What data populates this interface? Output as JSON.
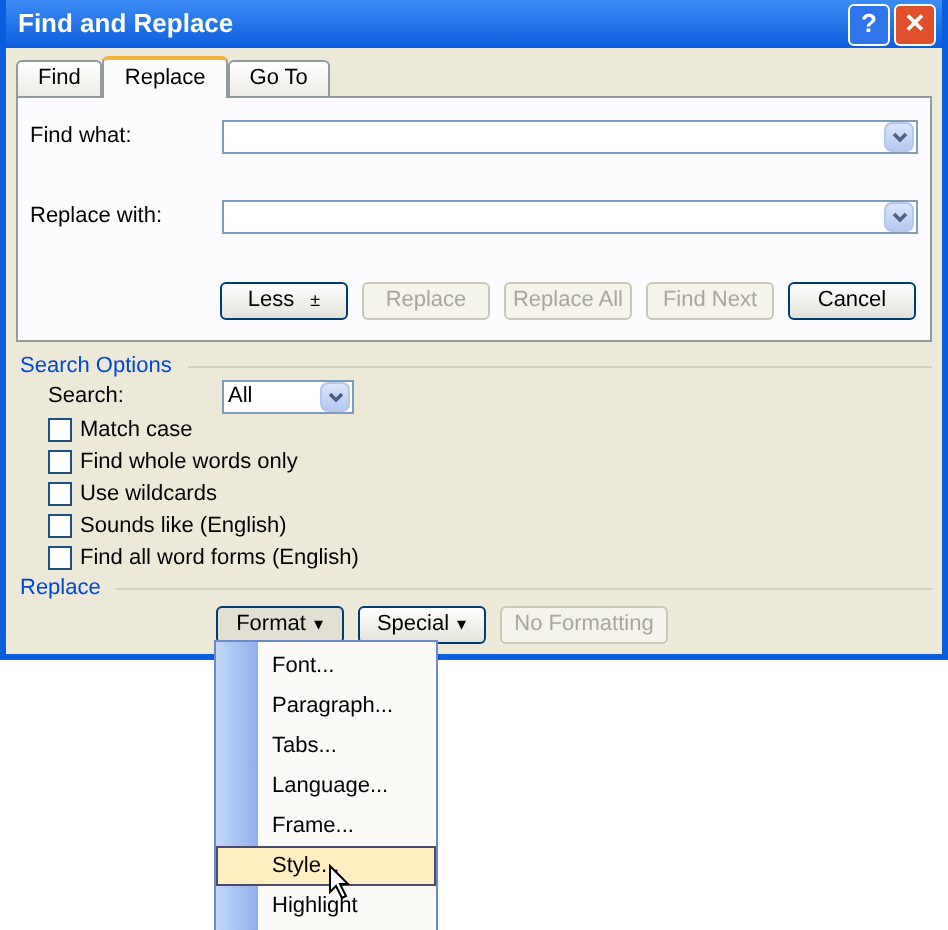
{
  "window": {
    "title": "Find and Replace"
  },
  "title_buttons": [
    {
      "kind": "help",
      "label": "?"
    },
    {
      "kind": "close",
      "label": "✕"
    }
  ],
  "tabs": [
    {
      "label": "Find",
      "selected": false
    },
    {
      "label": "Replace",
      "selected": true
    },
    {
      "label": "Go To",
      "selected": false
    }
  ],
  "fields": [
    {
      "label": "Find what:"
    },
    {
      "label": "Replace with:"
    }
  ],
  "actions": [
    {
      "label": "Less",
      "arrow": "±",
      "disabled": false
    },
    {
      "label": "Replace",
      "disabled": true
    },
    {
      "label": "Replace All",
      "disabled": true
    },
    {
      "label": "Find Next",
      "disabled": true
    },
    {
      "label": "Cancel",
      "disabled": false
    }
  ],
  "search_options": {
    "heading": "Search Options",
    "search_label": "Search:",
    "search_value": "All",
    "checkboxes": [
      {
        "label": "Match case",
        "checked": false
      },
      {
        "label": "Find whole words only",
        "checked": false
      },
      {
        "label": "Use wildcards",
        "checked": false
      },
      {
        "label": "Sounds like (English)",
        "checked": false
      },
      {
        "label": "Find all word forms (English)",
        "checked": false
      }
    ]
  },
  "replace": {
    "heading": "Replace",
    "buttons": [
      {
        "label": "Format",
        "caret": "▾",
        "pressed": true,
        "disabled": false
      },
      {
        "label": "Special",
        "caret": "▾",
        "pressed": false,
        "disabled": false
      },
      {
        "label": "No Formatting",
        "pressed": false,
        "disabled": true
      }
    ]
  },
  "format_menu": [
    {
      "label": "Font...",
      "selected": false
    },
    {
      "label": "Paragraph...",
      "selected": false
    },
    {
      "label": "Tabs...",
      "selected": false
    },
    {
      "label": "Language...",
      "selected": false
    },
    {
      "label": "Frame...",
      "selected": false
    },
    {
      "label": "Style...",
      "selected": true
    },
    {
      "label": "Highlight",
      "selected": false
    }
  ]
}
